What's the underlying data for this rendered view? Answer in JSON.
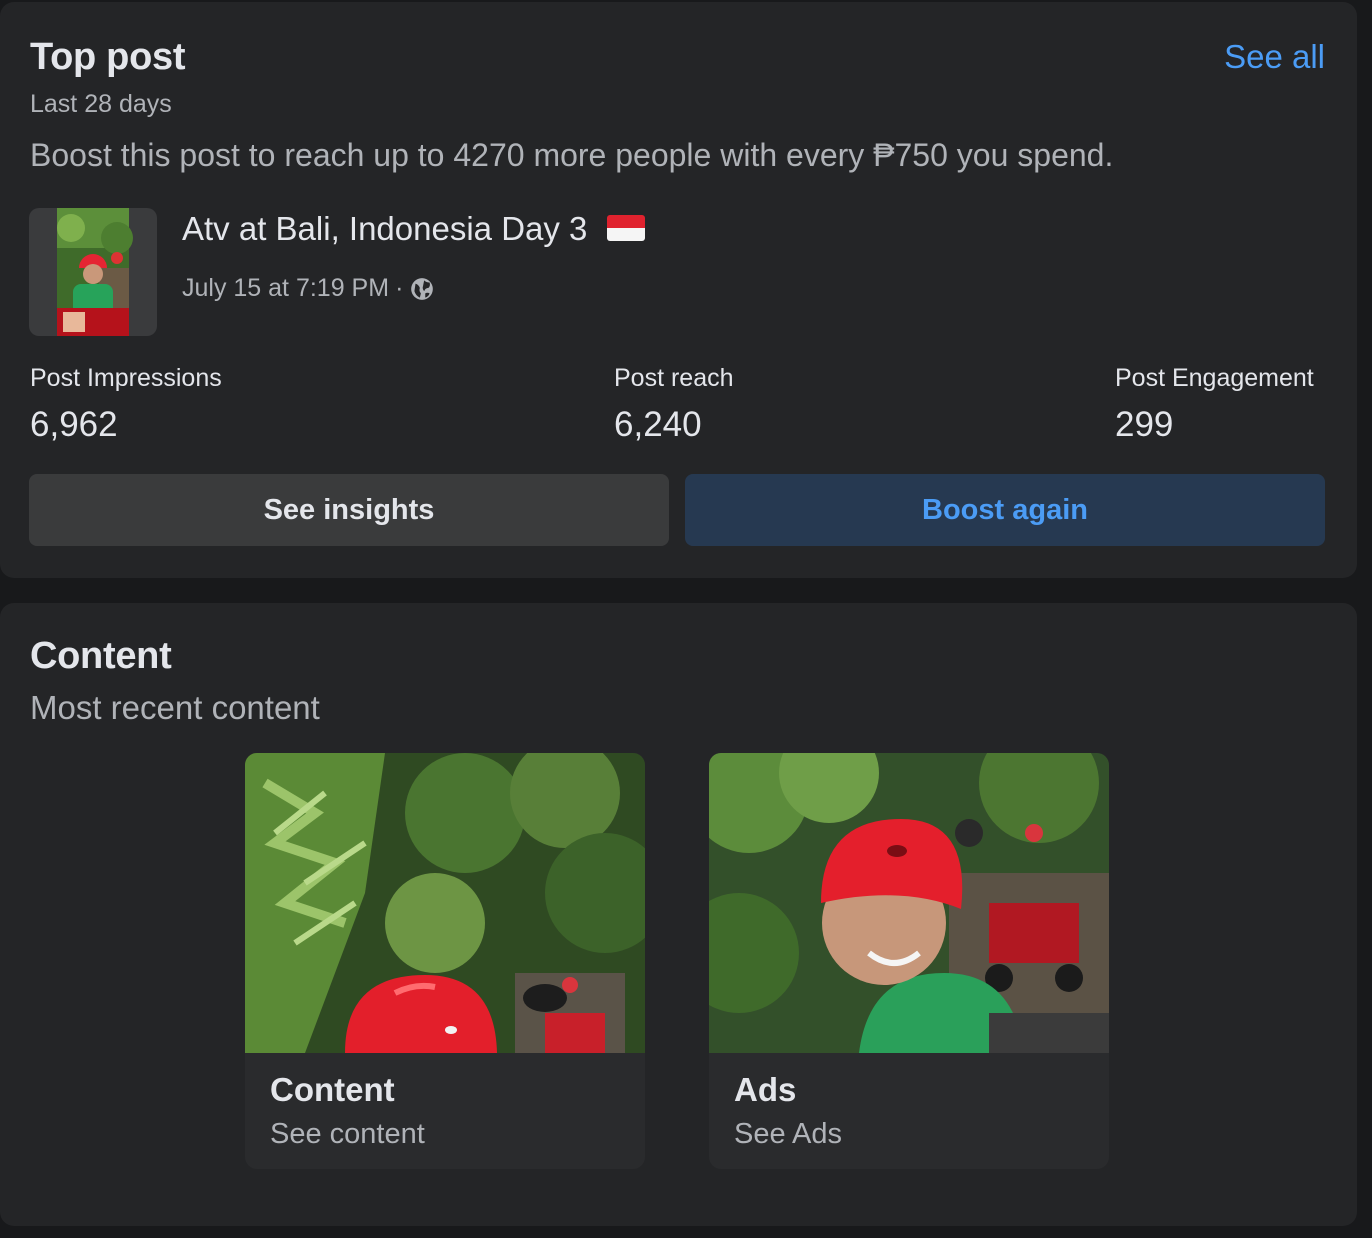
{
  "top_post": {
    "title": "Top post",
    "subtitle": "Last 28 days",
    "see_all": "See all",
    "boost_message": "Boost this post to reach up to 4270 more people with every ₱750 you spend.",
    "post": {
      "title": "Atv at Bali, Indonesia Day 3",
      "flag": "🇮🇩",
      "date": "July 15 at 7:19 PM",
      "separator": "·",
      "privacy_icon": "globe-icon"
    },
    "metrics": [
      {
        "label": "Post Impressions",
        "value": "6,962"
      },
      {
        "label": "Post reach",
        "value": "6,240"
      },
      {
        "label": "Post Engagement",
        "value": "299"
      }
    ],
    "buttons": {
      "insights": "See insights",
      "boost": "Boost again"
    }
  },
  "content": {
    "title": "Content",
    "subtitle": "Most recent content",
    "tiles": [
      {
        "title": "Content",
        "subtitle": "See content"
      },
      {
        "title": "Ads",
        "subtitle": "See Ads"
      }
    ]
  },
  "colors": {
    "background": "#18191b",
    "card": "#242527",
    "link": "#4b9cf5",
    "boost_button": "#263951",
    "secondary_button": "#3a3b3c"
  }
}
